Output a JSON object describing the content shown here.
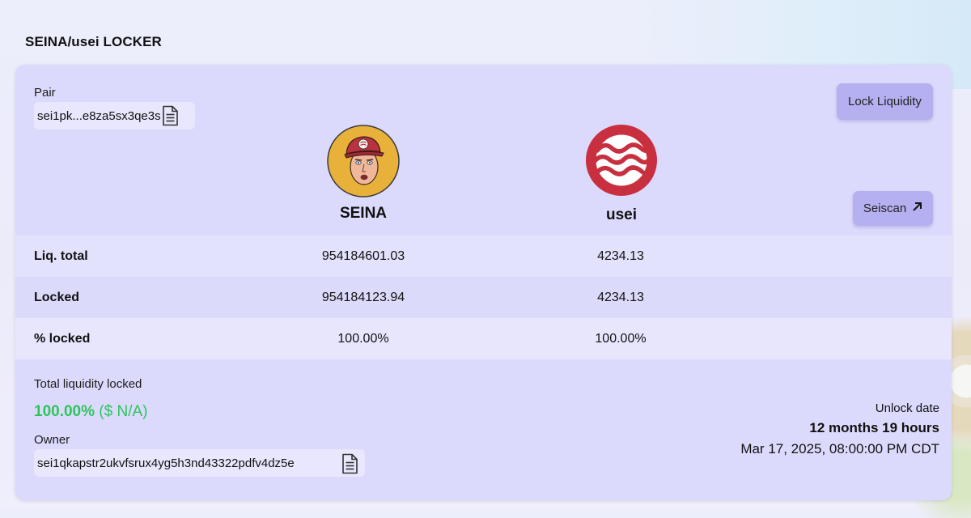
{
  "page": {
    "title": "SEINA/usei LOCKER"
  },
  "pair": {
    "label": "Pair",
    "address": "sei1pk...e8za5sx3qe3s"
  },
  "buttons": {
    "lock_liquidity": "Lock Liquidity",
    "seiscan": "Seiscan"
  },
  "tokens": [
    {
      "name": "SEINA",
      "logo": "seina-avatar"
    },
    {
      "name": "usei",
      "logo": "sei-logo"
    }
  ],
  "table": {
    "rows": [
      {
        "label": "Liq. total",
        "values": [
          "954184601.03",
          "4234.13"
        ]
      },
      {
        "label": "Locked",
        "values": [
          "954184123.94",
          "4234.13"
        ]
      },
      {
        "label": "% locked",
        "values": [
          "100.00%",
          "100.00%"
        ]
      }
    ]
  },
  "summary": {
    "total_label": "Total liquidity locked",
    "total_percent": "100.00%",
    "total_usd": "($ N/A)",
    "owner_label": "Owner",
    "owner_address": "sei1qkapstr2ukvfsrux4yg5h3nd43322pdfv4dz5e",
    "unlock_label": "Unlock date",
    "unlock_duration": "12 months 19 hours",
    "unlock_date": "Mar 17, 2025, 08:00:00 PM CDT"
  },
  "colors": {
    "card": "#dcdafc",
    "button": "#b5b0f0",
    "green": "#2cc55a",
    "usei_red": "#c8303f",
    "seina_yellow": "#e8b13a"
  }
}
